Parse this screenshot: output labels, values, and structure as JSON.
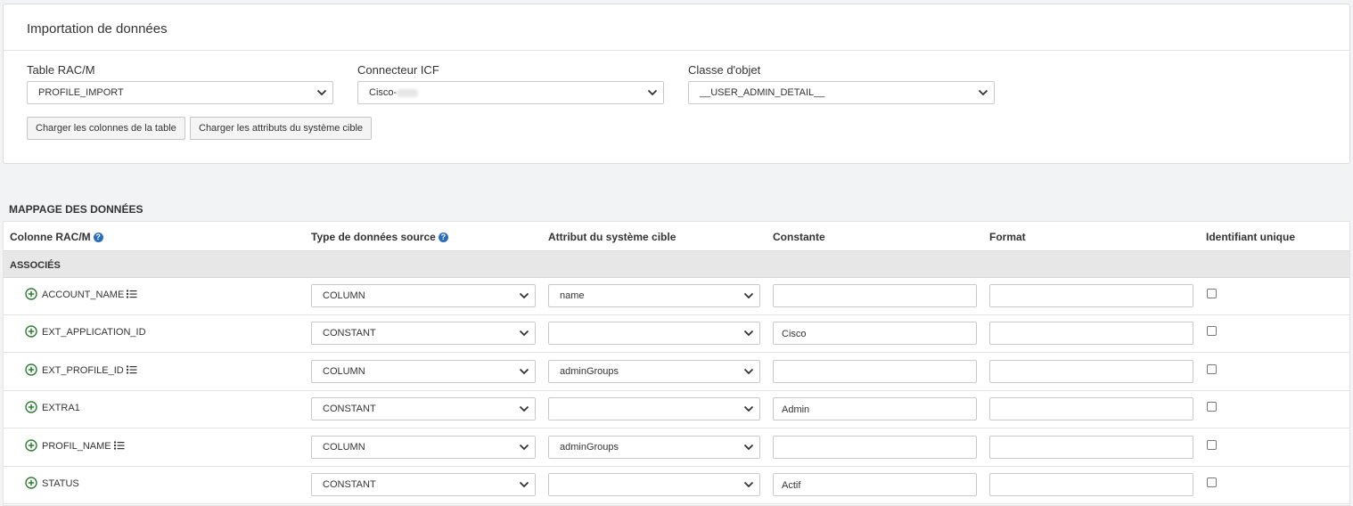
{
  "import_panel": {
    "title": "Importation de données",
    "table_label": "Table RAC/M",
    "table_value": "PROFILE_IMPORT",
    "connector_label": "Connecteur ICF",
    "connector_value": "Cisco-",
    "object_class_label": "Classe d'objet",
    "object_class_value": "__USER_ADMIN_DETAIL__",
    "load_columns_button": "Charger les colonnes de la table",
    "load_attributes_button": "Charger les attributs du système cible"
  },
  "mapping": {
    "section_title": "MAPPAGE DES DONNÉES",
    "headers": {
      "column": "Colonne RAC/M",
      "source_type": "Type de données source",
      "target_attribute": "Attribut du système cible",
      "constant": "Constante",
      "format": "Format",
      "unique_id": "Identifiant unique"
    },
    "group_label": "ASSOCIÉS",
    "rows": [
      {
        "name": "ACCOUNT_NAME",
        "list_icon": true,
        "source_type": "COLUMN",
        "attribute": "name",
        "constant": "",
        "format": "",
        "unique": false
      },
      {
        "name": "EXT_APPLICATION_ID",
        "list_icon": false,
        "source_type": "CONSTANT",
        "attribute": "",
        "constant": "Cisco",
        "format": "",
        "unique": false
      },
      {
        "name": "EXT_PROFILE_ID",
        "list_icon": true,
        "source_type": "COLUMN",
        "attribute": "adminGroups",
        "constant": "",
        "format": "",
        "unique": false
      },
      {
        "name": "EXTRA1",
        "list_icon": false,
        "source_type": "CONSTANT",
        "attribute": "",
        "constant": "Admin",
        "format": "",
        "unique": false
      },
      {
        "name": "PROFIL_NAME",
        "list_icon": true,
        "source_type": "COLUMN",
        "attribute": "adminGroups",
        "constant": "",
        "format": "",
        "unique": false
      },
      {
        "name": "STATUS",
        "list_icon": false,
        "source_type": "CONSTANT",
        "attribute": "",
        "constant": "Actif",
        "format": "",
        "unique": false
      }
    ]
  },
  "icons": {
    "add": "plus-circle-icon",
    "list": "list-icon",
    "help": "question-circle-icon",
    "dropdown": "chevron-down-icon"
  },
  "colors": {
    "add_icon": "#2e7d32",
    "help_icon": "#2a6ebb",
    "group_row_bg": "#e7e7e7"
  }
}
